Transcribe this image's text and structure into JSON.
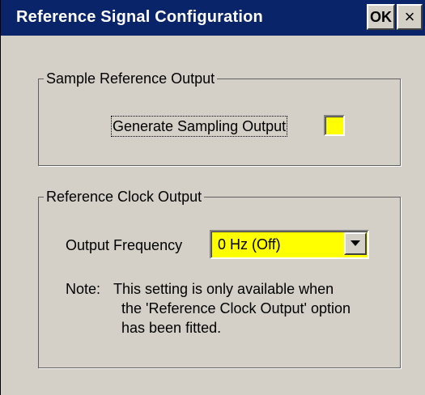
{
  "window": {
    "title": "Reference Signal Configuration",
    "ok_label": "OK",
    "close_label": "×"
  },
  "sample_group": {
    "label": "Sample Reference Output",
    "checkbox_label": "Generate Sampling Output",
    "checkbox_checked": false,
    "checkbox_color": "#ffff00"
  },
  "clock_group": {
    "label": "Reference Clock Output",
    "frequency_label": "Output Frequency",
    "frequency_value": "0 Hz (Off)",
    "frequency_bg_color": "#ffff00",
    "note_label": "Note:",
    "note_lines": [
      "This setting is only available when",
      "the 'Reference Clock Output' option",
      "has been fitted."
    ]
  },
  "colors": {
    "titlebar": "#0a246a",
    "dialog_bg": "#d4d0c8"
  },
  "icons": {
    "dropdown": "chevron-down-icon",
    "close": "close-icon"
  }
}
